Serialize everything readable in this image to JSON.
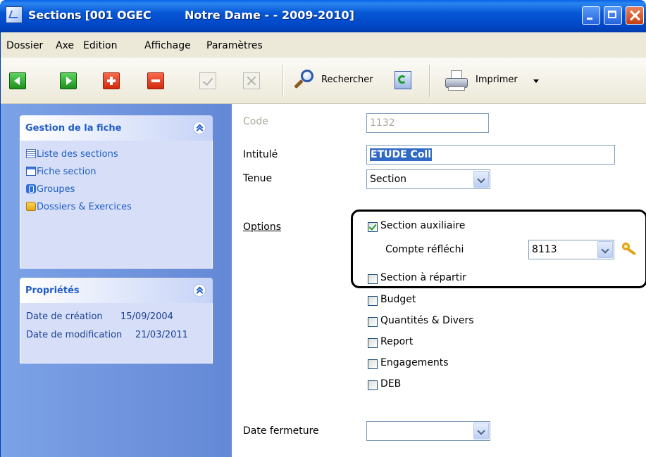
{
  "window": {
    "title": "Sections [001 OGEC",
    "title_suffix": "Notre Dame - - 2009-2010]"
  },
  "menu": [
    "Dossier",
    "Axe",
    "Edition",
    "Affichage",
    "Paramètres"
  ],
  "toolbar": {
    "search_label": "Rechercher",
    "print_label": "Imprimer"
  },
  "sidebar": {
    "gestion": {
      "title": "Gestion de la fiche",
      "items": [
        {
          "label": "Liste des sections",
          "icon": "list-icon"
        },
        {
          "label": "Fiche section",
          "icon": "form-icon"
        },
        {
          "label": "Groupes",
          "icon": "groups-icon"
        },
        {
          "label": "Dossiers & Exercices",
          "icon": "folder-icon"
        }
      ]
    },
    "proprietes": {
      "title": "Propriétés",
      "rows": [
        {
          "label": "Date de création",
          "value": "15/09/2004"
        },
        {
          "label": "Date de modification",
          "value": "21/03/2011"
        }
      ]
    }
  },
  "form": {
    "code": {
      "label": "Code",
      "value": "1132"
    },
    "intitule": {
      "label": "Intitulé",
      "value": "ETUDE Coll"
    },
    "tenue": {
      "label": "Tenue",
      "value": "Section"
    },
    "options_label": "Options",
    "section_auxiliaire": {
      "label": "Section auxiliaire",
      "checked": true
    },
    "compte_reflechi": {
      "label": "Compte réfléchi",
      "value": "8113"
    },
    "checkboxes": [
      {
        "label": "Section à répartir",
        "checked": false
      },
      {
        "label": "Budget",
        "checked": false
      },
      {
        "label": "Quantités & Divers",
        "checked": false
      },
      {
        "label": "Report",
        "checked": false
      },
      {
        "label": "Engagements",
        "checked": false
      },
      {
        "label": "DEB",
        "checked": false
      }
    ],
    "date_fermeture": {
      "label": "Date fermeture",
      "value": ""
    }
  },
  "colors": {
    "titlebar": "#0049c8",
    "sidebar": "#6f92dc",
    "link": "#215dc6",
    "selection": "#316ac5"
  }
}
